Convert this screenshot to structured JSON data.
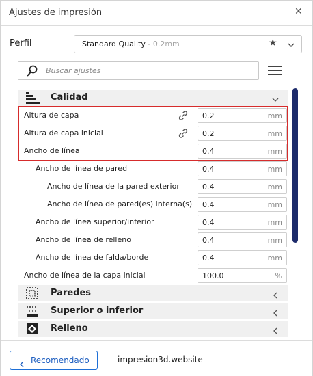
{
  "window": {
    "title": "Ajustes de impresión",
    "close_glyph": "✕"
  },
  "profile": {
    "label": "Perfil",
    "name": "Standard Quality",
    "suffix": " - 0.2mm"
  },
  "search": {
    "placeholder": "Buscar ajustes"
  },
  "categories": {
    "calidad": "Calidad",
    "paredes": "Paredes",
    "superior": "Superior o inferior",
    "relleno": "Relleno"
  },
  "settings": [
    {
      "label": "Altura de capa",
      "value": "0.2",
      "unit": "mm"
    },
    {
      "label": "Altura de capa inicial",
      "value": "0.2",
      "unit": "mm"
    },
    {
      "label": "Ancho de línea",
      "value": "0.4",
      "unit": "mm"
    },
    {
      "label": "Ancho de línea de pared",
      "value": "0.4",
      "unit": "mm"
    },
    {
      "label": "Ancho de línea de la pared exterior",
      "value": "0.4",
      "unit": "mm"
    },
    {
      "label": "Ancho de línea de pared(es) interna(s)",
      "value": "0.4",
      "unit": "mm"
    },
    {
      "label": "Ancho de línea superior/inferior",
      "value": "0.4",
      "unit": "mm"
    },
    {
      "label": "Ancho de línea de relleno",
      "value": "0.4",
      "unit": "mm"
    },
    {
      "label": "Ancho de línea de falda/borde",
      "value": "0.4",
      "unit": "mm"
    },
    {
      "label": "Ancho de línea de la capa inicial",
      "value": "100.0",
      "unit": "%"
    }
  ],
  "footer": {
    "recommended_label": "Recomendado",
    "site": "impresion3d.website"
  },
  "colors": {
    "accent": "#1e6fd6",
    "scrollbar": "#1d2b6b",
    "highlight": "#d62c2c"
  }
}
